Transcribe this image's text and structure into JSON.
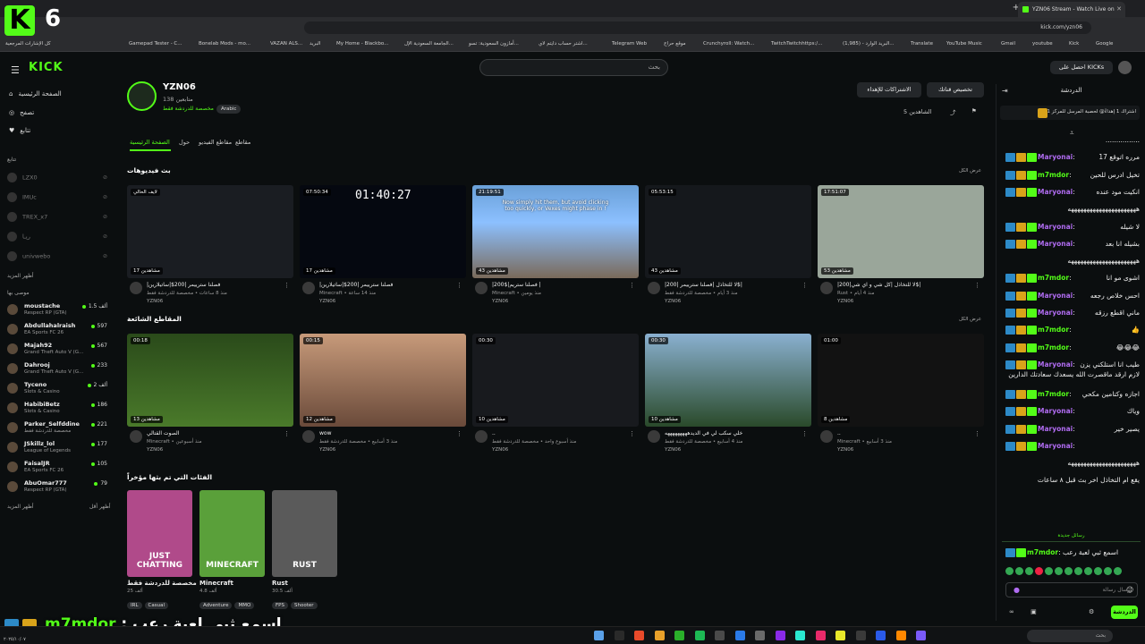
{
  "browser": {
    "tab_title": "YZN06 Stream - Watch Live on",
    "url": "kick.com/yzn06",
    "bookmarks": [
      "كل الإشارات المرجعية",
      "Gamepad Tester - C...",
      "Bonelab Mods - mo...",
      "VAZAN ALS...",
      "البريد",
      "My Home - Blackbo...",
      "الجامعة السعودية الإل...",
      "أمازون السعودية: تسو...",
      "اشتر حساب دايتم لاي...",
      "Telegram Web",
      "موقع حراج",
      "Crunchyroll: Watch...",
      "TwitchTwitchhttps:/...",
      "(1,985) - البريد الوارد...",
      "Translate",
      "YouTube Music",
      "Gmail",
      "youtube",
      "Kick",
      "Google"
    ]
  },
  "overlay_top": {
    "k_letter": "K",
    "number": "6"
  },
  "header": {
    "logo": "KICK",
    "search_placeholder": "بحث",
    "get_kicks": "احصل على KICKs"
  },
  "sidebar": {
    "nav": [
      {
        "icon": "⌂",
        "label": "الصفحة الرئيسية"
      },
      {
        "icon": "◎",
        "label": "تصفح"
      },
      {
        "icon": "♥",
        "label": "تتابع"
      }
    ],
    "following_header": "تتابع",
    "following": [
      {
        "name": "LZX0",
        "right": "⊘"
      },
      {
        "name": "IMUc",
        "right": "⊘"
      },
      {
        "name": "TREX_x7",
        "right": "⊘"
      },
      {
        "name": "ريـا",
        "right": "⊘"
      },
      {
        "name": "univwebo",
        "right": "⊘"
      }
    ],
    "show_more_1": "أظهر المزيد",
    "recommended_header": "موصى بها",
    "recommended": [
      {
        "name": "moustache",
        "category": "Respect RP (GTA)",
        "viewers": "1.5 ألف"
      },
      {
        "name": "Abdullahalraish",
        "category": "EA Sports FC 26",
        "viewers": "597"
      },
      {
        "name": "Majah92",
        "category": "Grand Theft Auto V (G...",
        "viewers": "567"
      },
      {
        "name": "Dahrooj",
        "category": "Grand Theft Auto V (G...",
        "viewers": "233"
      },
      {
        "name": "Tyceno",
        "category": "Slots & Casino",
        "viewers": "2 ألف"
      },
      {
        "name": "HabibiBetz",
        "category": "Slots & Casino",
        "viewers": "186"
      },
      {
        "name": "Parker_Selfddine",
        "category": "مخصصة للدردشة فقط",
        "viewers": "221"
      },
      {
        "name": "JSkillz_lol",
        "category": "League of Legends",
        "viewers": "177"
      },
      {
        "name": "FaisalJR",
        "category": "EA Sports FC 26",
        "viewers": "105"
      },
      {
        "name": "AbuOmar777",
        "category": "Respect RP (GTA)",
        "viewers": "79"
      }
    ],
    "show_more": "أظهر المزيد",
    "show_less": "أظهر أقل"
  },
  "channel": {
    "name": "YZN06",
    "followers": "138 متابعين",
    "category": "مخصصة للدردشة فقط",
    "language": "Arabic",
    "btn_customize": "تخصيص قناتك",
    "btn_subs": "الاشتراكات للإهداء",
    "viewers": "الشاهدين 5",
    "tabs": [
      "الصفحة الرئيسية",
      "حول",
      "مقاطع الفيديو",
      "مقاطع"
    ]
  },
  "videos_section": {
    "title": "بث فيديوهات",
    "see_all": "عرض الكل",
    "items": [
      {
        "duration": "لايف الحالي",
        "views": "17 مشاهدين",
        "title": "|فصلنا سترييمر |200$|ساتيلارين",
        "meta": "منذ 8 ساعات • مخصصة للدردشة فقط",
        "user": "YZN06"
      },
      {
        "duration": "07:50:34",
        "views": "17 مشاهدين",
        "title": "|فصلنا سترييمر |200$|ساتيلارين",
        "meta": "Minecraft • منذ 14 ساعة",
        "user": "YZN06",
        "bigtime": "01:40:27"
      },
      {
        "duration": "21:19:51",
        "views": "43 مشاهدين",
        "title": "|200$|فصلنا ستريم |",
        "meta": "Minecraft • منذ يومين",
        "user": "YZN06",
        "overlay_text": "Now simply hit them, but avoid clicking too quickly, or Vexes might phase in !"
      },
      {
        "duration": "05:53:15",
        "views": "43 مشاهدين",
        "title": "|لا للتخاذل |فصلنا سترييمر |200$|",
        "meta": "منذ 3 أيام • مخصصة للدردشة فقط",
        "user": "YZN06"
      },
      {
        "duration": "17:51:07",
        "views": "53 مشاهدين",
        "title": "|لا للتخاذل |كل شي و اي شي|200$|",
        "meta": "Rust • منذ 4 أيام",
        "user": "YZN06"
      }
    ]
  },
  "clips_section": {
    "title": "المقاطع الشائعة",
    "see_all": "عرض الكل",
    "items": [
      {
        "duration": "00:18",
        "views": "13 مشاهدين",
        "title": "الصوت القتالي",
        "meta": "Minecraft • منذ أسبوعين",
        "user": "YZN06"
      },
      {
        "duration": "00:15",
        "views": "12 مشاهدين",
        "title": "wow",
        "meta": "منذ 3 أسابيع • مخصصة للدردشة فقط",
        "user": "YZN06"
      },
      {
        "duration": "00:30",
        "views": "10 مشاهدين",
        "title": "..",
        "meta": "منذ أسبوع واحد • مخصصة للدردشة فقط",
        "user": "YZN06"
      },
      {
        "duration": "00:30",
        "views": "10 مشاهدين",
        "title": "خلي سكب لي في الديدهههههههههه",
        "meta": "منذ 4 أسابيع • مخصصة للدردشة فقط",
        "user": "YZN06"
      },
      {
        "duration": "01:00",
        "views": "8 مشاهدين",
        "title": "..",
        "meta": "Minecraft • منذ 3 أسابيع",
        "user": "YZN06"
      }
    ]
  },
  "categories_section": {
    "title": "الفئات التي تم بثها مؤخراً",
    "items": [
      {
        "name": "مخصصة للدردشة فقط",
        "viewers": "25 ألف",
        "tags": [
          "IRL",
          "Casual"
        ],
        "art": "JUST CHATTING",
        "color": "#b04a8a"
      },
      {
        "name": "Minecraft",
        "viewers": "4.8 ألف",
        "tags": [
          "Adventure",
          "MMO"
        ],
        "art": "MINECRAFT",
        "color": "#5aa03a"
      },
      {
        "name": "Rust",
        "viewers": "30.5 ألف",
        "tags": [
          "FPS",
          "Shooter"
        ],
        "art": "RUST",
        "color": "#5a5a5a"
      }
    ]
  },
  "chat": {
    "header": "الدردشة",
    "pinned": "اشتراك 1 إهداءً@ لحصبة المرسل للمركز 1",
    "messages": [
      {
        "user": "",
        "text": "................"
      },
      {
        "user": "Maryonai",
        "text": "مرره اتوقع 17",
        "cls": "u1"
      },
      {
        "user": "m7mdor",
        "text": "تخيل ادرس للحين",
        "cls": "u2"
      },
      {
        "user": "Maryonai",
        "text": "انكيت مود عنده",
        "cls": "u1"
      },
      {
        "user": "",
        "text": "ههههههههههههههههههههههه"
      },
      {
        "user": "Maryonai",
        "text": "لا شيله",
        "cls": "u1"
      },
      {
        "user": "Maryonai",
        "text": "بشيله انا بعد",
        "cls": "u1"
      },
      {
        "user": "",
        "text": "ههههههههههههههههههههههه"
      },
      {
        "user": "m7mdor",
        "text": "اشوى مو انا",
        "cls": "u2"
      },
      {
        "user": "Maryonai",
        "text": "احس خلاص رجعه",
        "cls": "u1"
      },
      {
        "user": "Maryonai",
        "text": "ماني اقطع رزقه",
        "cls": "u1"
      },
      {
        "user": "m7mdor",
        "text": "👍",
        "cls": "u2"
      },
      {
        "user": "m7mdor",
        "text": "😂😂😂",
        "cls": "u2"
      },
      {
        "user": "Maryonai",
        "text": "طيب انا استلكني يزن لازم ارقد ماقصرت الله يسعدك سعادتك الدارين",
        "cls": "u1"
      },
      {
        "user": "m7mdor",
        "text": "اجازه وكتامين مكحي",
        "cls": "u2"
      },
      {
        "user": "Maryonai",
        "text": "وياك",
        "cls": "u1"
      },
      {
        "user": "Maryonai",
        "text": "يصير خير",
        "cls": "u1"
      },
      {
        "user": "Maryonai",
        "text": "",
        "cls": "u1"
      },
      {
        "user": "",
        "text": "ههههههههههههههههههههههه"
      },
      {
        "user": "",
        "text": "يقع ام التخاذل اخر بث قبل ٨ ساعات"
      }
    ],
    "new_messages": "رسائل جديدة",
    "last_msg_user": "m7mdor",
    "last_msg_text": "اسمع ثبي لعبة رعب",
    "input_placeholder": "إرسال رسالة",
    "send": "الدردشة"
  },
  "overlay_bottom": {
    "name": "m7mdor",
    "text": ": اسمع ثبي لعبة رعب"
  },
  "taskbar": {
    "search": "بحث",
    "clock": "٢٠٢٥/١٠/٠٧"
  }
}
